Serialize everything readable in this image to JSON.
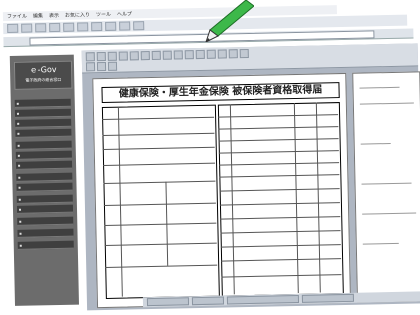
{
  "window": {
    "menu": [
      "ファイル",
      "編集",
      "表示",
      "お気に入り",
      "ツール",
      "ヘルプ"
    ]
  },
  "sidebar": {
    "header_title": "ｅ-Gov",
    "header_sub": "電子政府の総合窓口",
    "items": [
      "",
      "",
      "",
      "",
      "",
      "",
      "",
      "",
      "",
      "",
      "",
      "",
      "",
      ""
    ]
  },
  "document": {
    "title": "健康保険・厚生年金保険 被保険者資格取得届"
  },
  "colors": {
    "sidebar": "#6c6c6c",
    "viewer_bg": "#aeb6c2",
    "pen": "#3db84a"
  },
  "icons": {
    "pen": "pen-icon"
  }
}
